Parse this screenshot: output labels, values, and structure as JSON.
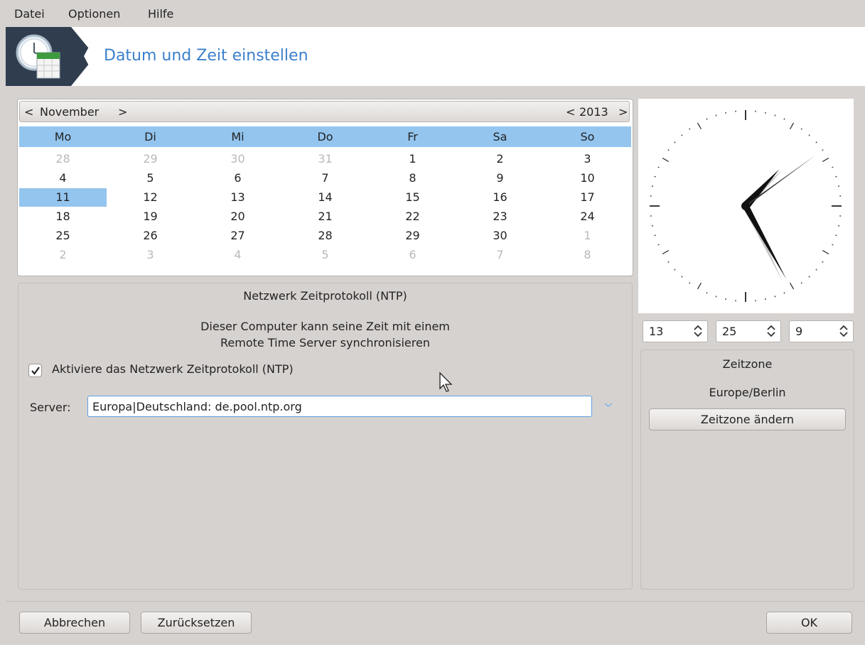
{
  "menu": [
    "Datei",
    "Optionen",
    "Hilfe"
  ],
  "header": {
    "title": "Datum und Zeit einstellen",
    "icon": "clock-calendar-icon"
  },
  "calendar": {
    "month": "November",
    "year": "2013",
    "prev_month": "<",
    "next_month": ">",
    "prev_year": "<",
    "next_year": ">",
    "weekdays": [
      "Mo",
      "Di",
      "Mi",
      "Do",
      "Fr",
      "Sa",
      "So"
    ],
    "weeks": [
      [
        "28",
        "29",
        "30",
        "31",
        "1",
        "2",
        "3"
      ],
      [
        "4",
        "5",
        "6",
        "7",
        "8",
        "9",
        "10"
      ],
      [
        "11",
        "12",
        "13",
        "14",
        "15",
        "16",
        "17"
      ],
      [
        "18",
        "19",
        "20",
        "21",
        "22",
        "23",
        "24"
      ],
      [
        "25",
        "26",
        "27",
        "28",
        "29",
        "30",
        "1"
      ],
      [
        "2",
        "3",
        "4",
        "5",
        "6",
        "7",
        "8"
      ]
    ],
    "selected_day": "11",
    "highlight_color": "#93c5ef"
  },
  "ntp": {
    "title": "Netzwerk Zeitprotokoll (NTP)",
    "description_line1": "Dieser Computer kann seine Zeit mit einem",
    "description_line2": "Remote Time Server synchronisieren",
    "enable_label": "Aktiviere das Netzwerk Zeitprotokoll (NTP)",
    "enabled": true,
    "server_label": "Server:",
    "server_value": "Europa|Deutschland: de.pool.ntp.org"
  },
  "time": {
    "hour": "13",
    "minute": "25",
    "second": "9"
  },
  "timezone": {
    "title": "Zeitzone",
    "value": "Europe/Berlin",
    "change_button": "Zeitzone ändern"
  },
  "footer": {
    "cancel": "Abbrechen",
    "reset": "Zurücksetzen",
    "ok": "OK"
  },
  "accent_color": "#3c80cc"
}
